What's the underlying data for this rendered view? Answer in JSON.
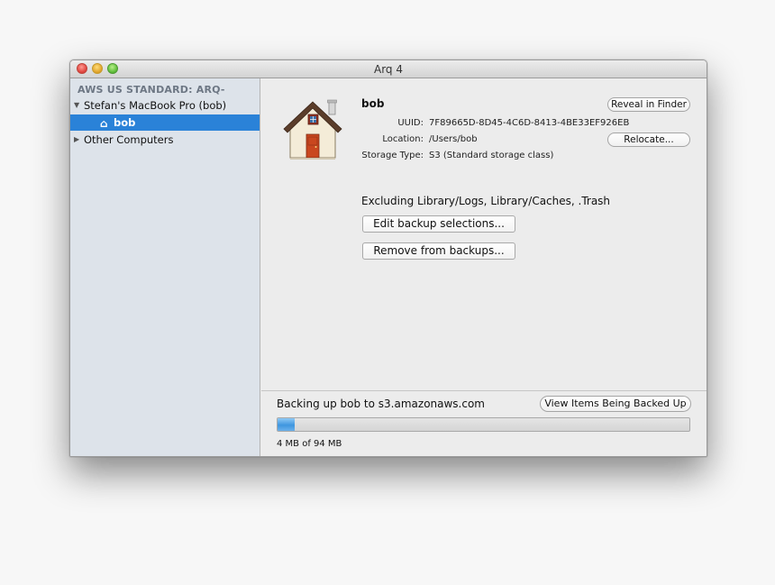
{
  "window": {
    "title": "Arq 4"
  },
  "sidebar": {
    "header": "AWS US STANDARD: ARQ-",
    "computer": {
      "label": "Stefan's MacBook Pro (bob)",
      "expanded": true
    },
    "selected_item": {
      "label": "bob",
      "icon": "home-icon"
    },
    "other": {
      "label": "Other Computers",
      "expanded": false
    }
  },
  "folder": {
    "name": "bob",
    "uuid_label": "UUID:",
    "uuid": "7F89665D-8D45-4C6D-8413-4BE33EF926EB",
    "location_label": "Location:",
    "location": "/Users/bob",
    "storage_label": "Storage Type:",
    "storage": "S3 (Standard storage class)",
    "icon": "house-icon"
  },
  "buttons": {
    "reveal": "Reveal in Finder",
    "relocate": "Relocate...",
    "edit": "Edit backup selections...",
    "remove": "Remove from backups...",
    "view_items": "View Items Being Backed Up"
  },
  "exclusions": "Excluding Library/Logs, Library/Caches, .Trash",
  "backup": {
    "status": "Backing up bob to s3.amazonaws.com",
    "progress_text": "4 MB of 94 MB",
    "progress_fraction": 0.0426
  },
  "colors": {
    "selection": "#2a82d8",
    "sidebar_bg": "#dde3ea",
    "progress_fill": "#3f96df"
  }
}
